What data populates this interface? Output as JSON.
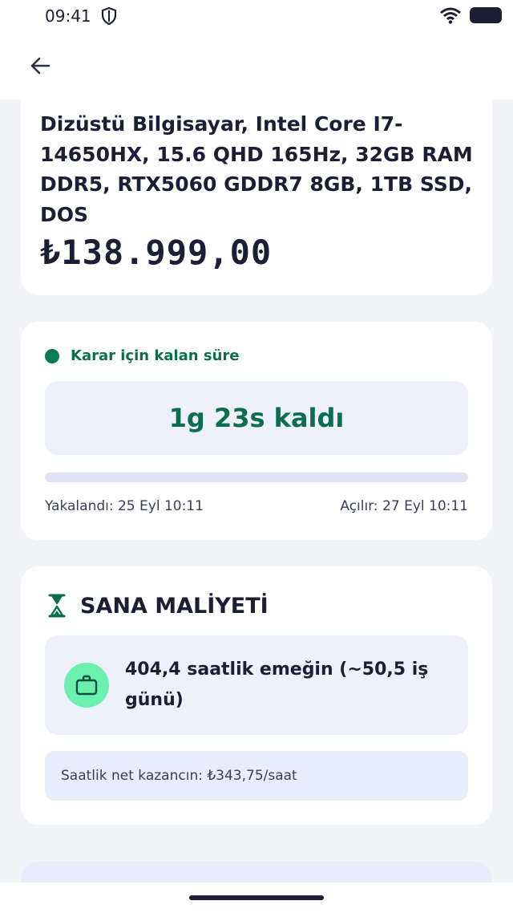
{
  "status_bar": {
    "time": "09:41"
  },
  "product": {
    "title": "Dizüstü Bilgisayar, Intel Core I7-14650HX, 15.6 QHD 165Hz, 32GB RAM DDR5, RTX5060 GDDR7 8GB, 1TB SSD, DOS",
    "price": "₺138.999,00"
  },
  "timer": {
    "label": "Karar için kalan süre",
    "remaining": "1g 23s kaldı",
    "progress": 0.0,
    "caught": "Yakalandı: 25 Eyl 10:11",
    "opens": "Açılır: 27 Eyl 10:11",
    "accent": "#0b7a56"
  },
  "cost": {
    "title": "SANA MALİYETİ",
    "labor_text": "404,4 saatlik emeğin (~50,5 iş günü)",
    "hourly_wage": "Saatlik net kazancın: ₺343,75/saat"
  },
  "icons": {
    "back": "arrow-left-icon",
    "shield": "shield-icon",
    "wifi": "wifi-icon",
    "battery": "battery-icon",
    "hourglass": "hourglass-icon",
    "briefcase": "briefcase-icon"
  }
}
